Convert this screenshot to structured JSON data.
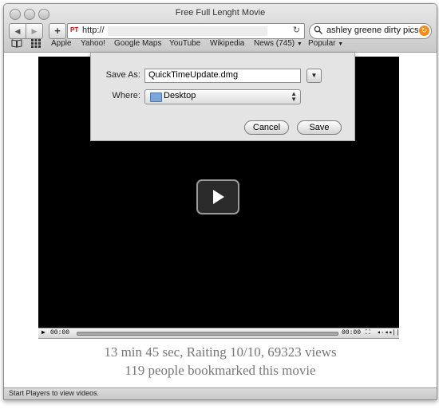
{
  "window": {
    "title": "Free Full Lenght Movie"
  },
  "toolbar": {
    "back_icon": "back-arrow-icon",
    "forward_icon": "forward-arrow-icon",
    "add_icon": "plus-icon",
    "add_label": "+",
    "url_favicon": "PT",
    "url": "http://",
    "reload_glyph": "↻",
    "search_value": "ashley greene dirty pics",
    "search_go_glyph": "↻"
  },
  "bookmarks": {
    "items": [
      {
        "label": "Apple"
      },
      {
        "label": "Yahoo!"
      },
      {
        "label": "Google Maps"
      },
      {
        "label": "YouTube"
      },
      {
        "label": "Wikipedia"
      },
      {
        "label": "News (745)"
      },
      {
        "label": "Popular"
      }
    ]
  },
  "save_dialog": {
    "save_as_label": "Save As:",
    "filename": "QuickTimeUpdate.dmg",
    "where_label": "Where:",
    "location": "Desktop",
    "cancel_label": "Cancel",
    "save_label": "Save"
  },
  "player": {
    "time_elapsed": "00:00",
    "time_remaining": "00:00",
    "volume_glyph": "◂·◂◂||"
  },
  "movie_info": {
    "stats": "13 min 45 sec, Raiting 10/10, 69323 views",
    "bookmarks": "119 people bookmarked this movie"
  },
  "status_bar": {
    "text": "Start Players to view videos."
  },
  "colors": {
    "accent_search_go": "#f28a1c",
    "video_background": "#000000",
    "info_text": "#777777"
  }
}
